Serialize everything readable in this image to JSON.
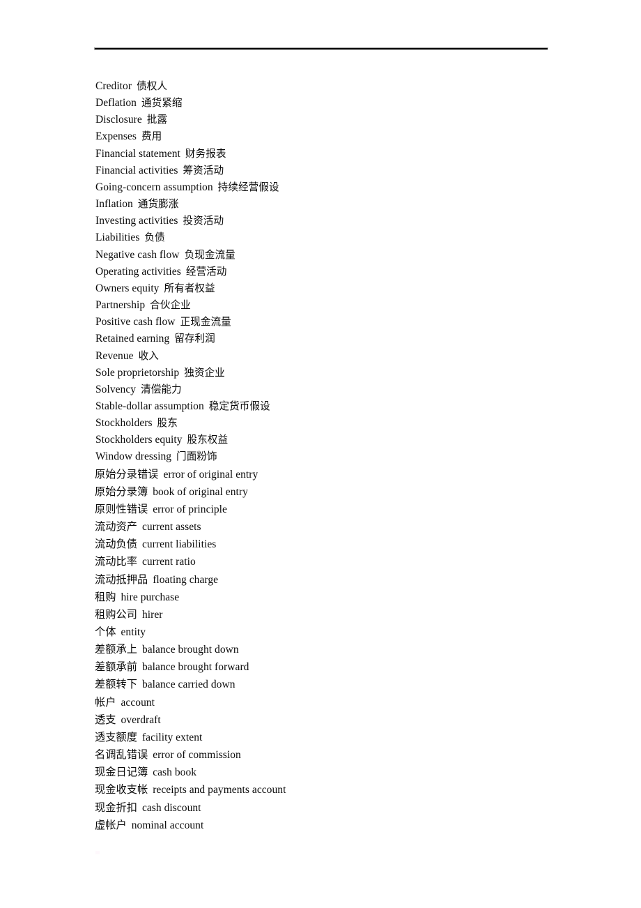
{
  "document": {
    "type": "glossary",
    "title": "Accounting terms glossary (English–Chinese)",
    "background_color": "#ffffff",
    "text_color": "#000000",
    "rule_color": "#000000"
  },
  "header": {
    "rule_present": true
  },
  "glossary": {
    "entries": [
      {
        "head": "Creditor",
        "gloss": "债权人",
        "head_lang": "en"
      },
      {
        "head": "Deflation",
        "gloss": "通货紧缩",
        "head_lang": "en"
      },
      {
        "head": "Disclosure",
        "gloss": "批露",
        "head_lang": "en"
      },
      {
        "head": "Expenses",
        "gloss": "费用",
        "head_lang": "en"
      },
      {
        "head": "Financial statement",
        "gloss": "财务报表",
        "head_lang": "en"
      },
      {
        "head": "Financial activities",
        "gloss": "筹资活动",
        "head_lang": "en"
      },
      {
        "head": "Going-concern assumption",
        "gloss": "持续经营假设",
        "head_lang": "en"
      },
      {
        "head": "Inflation",
        "gloss": "通货膨涨",
        "head_lang": "en"
      },
      {
        "head": "Investing activities",
        "gloss": "投资活动",
        "head_lang": "en"
      },
      {
        "head": "Liabilities",
        "gloss": "负债",
        "head_lang": "en"
      },
      {
        "head": "Negative cash flow",
        "gloss": "负现金流量",
        "head_lang": "en"
      },
      {
        "head": "Operating activities",
        "gloss": "经营活动",
        "head_lang": "en"
      },
      {
        "head": "Owners equity",
        "gloss": "所有者权益",
        "head_lang": "en"
      },
      {
        "head": "Partnership",
        "gloss": "合伙企业",
        "head_lang": "en"
      },
      {
        "head": "Positive cash flow",
        "gloss": "正现金流量",
        "head_lang": "en"
      },
      {
        "head": "Retained earning",
        "gloss": "留存利润",
        "head_lang": "en"
      },
      {
        "head": "Revenue",
        "gloss": "收入",
        "head_lang": "en"
      },
      {
        "head": "Sole proprietorship",
        "gloss": "独资企业",
        "head_lang": "en"
      },
      {
        "head": "Solvency",
        "gloss": "清偿能力",
        "head_lang": "en"
      },
      {
        "head": "Stable-dollar assumption",
        "gloss": "稳定货币假设",
        "head_lang": "en"
      },
      {
        "head": "Stockholders",
        "gloss": "股东",
        "head_lang": "en"
      },
      {
        "head": "Stockholders equity",
        "gloss": "股东权益",
        "head_lang": "en"
      },
      {
        "head": "Window dressing",
        "gloss": "门面粉饰",
        "head_lang": "en"
      },
      {
        "head": "原始分录错误",
        "gloss": "error of original entry",
        "head_lang": "zh"
      },
      {
        "head": "原始分录簿",
        "gloss": "book of original entry",
        "head_lang": "zh"
      },
      {
        "head": "原则性错误",
        "gloss": "error of principle",
        "head_lang": "zh"
      },
      {
        "head": "流动资产",
        "gloss": "current assets",
        "head_lang": "zh"
      },
      {
        "head": "流动负债",
        "gloss": "current liabilities",
        "head_lang": "zh"
      },
      {
        "head": "流动比率",
        "gloss": "current ratio",
        "head_lang": "zh"
      },
      {
        "head": "流动抵押品",
        "gloss": "floating charge",
        "head_lang": "zh"
      },
      {
        "head": "租购",
        "gloss": "hire purchase",
        "head_lang": "zh"
      },
      {
        "head": "租购公司",
        "gloss": "hirer",
        "head_lang": "zh"
      },
      {
        "head": "个体",
        "gloss": "entity",
        "head_lang": "zh"
      },
      {
        "head": "差额承上",
        "gloss": "balance brought down",
        "head_lang": "zh"
      },
      {
        "head": "差额承前",
        "gloss": "balance brought forward",
        "head_lang": "zh"
      },
      {
        "head": "差额转下",
        "gloss": "balance carried down",
        "head_lang": "zh"
      },
      {
        "head": "帐户",
        "gloss": "account",
        "head_lang": "zh"
      },
      {
        "head": "透支",
        "gloss": "overdraft",
        "head_lang": "zh"
      },
      {
        "head": "透支额度",
        "gloss": "facility extent",
        "head_lang": "zh"
      },
      {
        "head": "名调乱错误",
        "gloss": "error of commission",
        "head_lang": "zh"
      },
      {
        "head": "现金日记簿",
        "gloss": "cash book",
        "head_lang": "zh"
      },
      {
        "head": "现金收支帐",
        "gloss": "receipts and payments account",
        "head_lang": "zh"
      },
      {
        "head": "现金折扣",
        "gloss": "cash discount",
        "head_lang": "zh"
      },
      {
        "head": "虚帐户",
        "gloss": "nominal account",
        "head_lang": "zh"
      }
    ]
  }
}
